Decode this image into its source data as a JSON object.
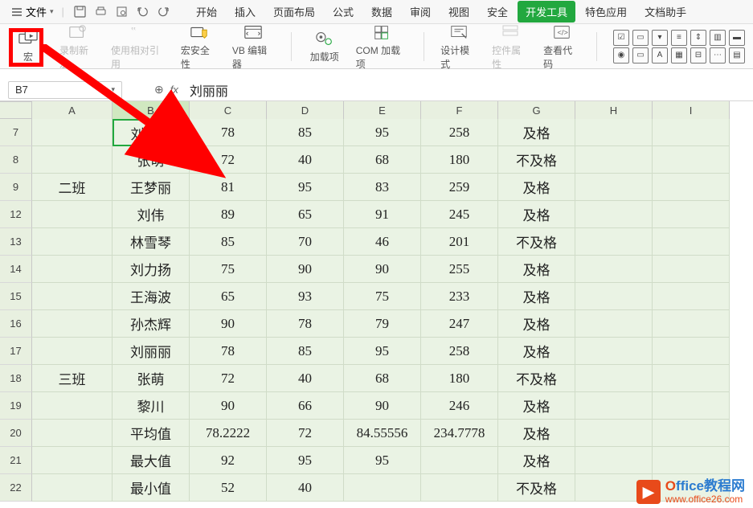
{
  "file_menu": {
    "label": "文件"
  },
  "tabs": [
    "开始",
    "插入",
    "页面布局",
    "公式",
    "数据",
    "审阅",
    "视图",
    "安全",
    "开发工具",
    "特色应用",
    "文档助手"
  ],
  "tabs_active_index": 8,
  "ribbon": {
    "macro": "宏",
    "record_macro": "录制新宏",
    "relative_ref": "使用相对引用",
    "macro_security": "宏安全性",
    "vb_editor": "VB 编辑器",
    "addins": "加载项",
    "com_addins": "COM 加载项",
    "design_mode": "设计模式",
    "ctrl_props": "控件属性",
    "view_code": "查看代码"
  },
  "name_box": "B7",
  "fx": "fx",
  "formula_value": "刘丽丽",
  "columns": [
    "A",
    "B",
    "C",
    "D",
    "E",
    "F",
    "G",
    "H",
    "I"
  ],
  "rows": [
    {
      "n": "7",
      "cells": [
        "",
        "刘丽丽",
        "78",
        "85",
        "95",
        "258",
        "及格",
        "",
        ""
      ]
    },
    {
      "n": "8",
      "cells": [
        "",
        "张萌",
        "72",
        "40",
        "68",
        "180",
        "不及格",
        "",
        ""
      ]
    },
    {
      "n": "9",
      "cells": [
        "二班",
        "王梦丽",
        "81",
        "95",
        "83",
        "259",
        "及格",
        "",
        ""
      ]
    },
    {
      "n": "12",
      "cells": [
        "",
        "刘伟",
        "89",
        "65",
        "91",
        "245",
        "及格",
        "",
        ""
      ]
    },
    {
      "n": "13",
      "cells": [
        "",
        "林雪琴",
        "85",
        "70",
        "46",
        "201",
        "不及格",
        "",
        ""
      ]
    },
    {
      "n": "14",
      "cells": [
        "",
        "刘力扬",
        "75",
        "90",
        "90",
        "255",
        "及格",
        "",
        ""
      ]
    },
    {
      "n": "15",
      "cells": [
        "",
        "王海波",
        "65",
        "93",
        "75",
        "233",
        "及格",
        "",
        ""
      ]
    },
    {
      "n": "16",
      "cells": [
        "",
        "孙杰辉",
        "90",
        "78",
        "79",
        "247",
        "及格",
        "",
        ""
      ]
    },
    {
      "n": "17",
      "cells": [
        "",
        "刘丽丽",
        "78",
        "85",
        "95",
        "258",
        "及格",
        "",
        ""
      ]
    },
    {
      "n": "18",
      "cells": [
        "三班",
        "张萌",
        "72",
        "40",
        "68",
        "180",
        "不及格",
        "",
        ""
      ]
    },
    {
      "n": "19",
      "cells": [
        "",
        "黎川",
        "90",
        "66",
        "90",
        "246",
        "及格",
        "",
        ""
      ]
    },
    {
      "n": "20",
      "cells": [
        "",
        "平均值",
        "78.2222",
        "72",
        "84.55556",
        "234.7778",
        "及格",
        "",
        ""
      ]
    },
    {
      "n": "21",
      "cells": [
        "",
        "最大值",
        "92",
        "95",
        "95",
        "",
        "及格",
        "",
        ""
      ]
    },
    {
      "n": "22",
      "cells": [
        "",
        "最小值",
        "52",
        "40",
        "",
        "",
        "不及格",
        "",
        ""
      ]
    }
  ],
  "active_cell": {
    "row": "7",
    "col": "B"
  },
  "watermark": {
    "title_prefix": "O",
    "title_rest": "ffice教程网",
    "url": "www.office26.com"
  }
}
